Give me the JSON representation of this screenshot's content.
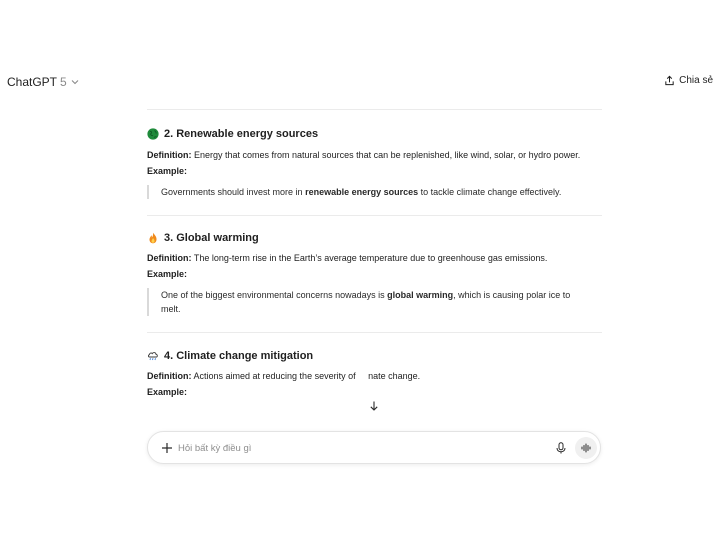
{
  "header": {
    "model_name": "ChatGPT",
    "model_version": "5",
    "share_label": "Chia sẻ"
  },
  "sections": [
    {
      "title": "2. Renewable energy sources",
      "icon": "globe-icon",
      "definition_label": "Definition:",
      "definition_text": " Energy that comes from natural sources that can be replenished, like wind, solar, or hydro power.",
      "example_label": "Example:",
      "example_before": "Governments should invest more in ",
      "example_bold": "renewable energy sources",
      "example_after": " to tackle climate change effectively."
    },
    {
      "title": "3. Global warming",
      "icon": "fire-icon",
      "definition_label": "Definition:",
      "definition_text": " The long-term rise in the Earth’s average temperature due to greenhouse gas emissions.",
      "example_label": "Example:",
      "example_before": "One of the biggest environmental concerns nowadays is ",
      "example_bold": "global warming",
      "example_after": ", which is causing polar ice to melt."
    },
    {
      "title": "4. Climate change mitigation",
      "icon": "cloud-rain-icon",
      "definition_label": "Definition:",
      "definition_text_1": " Actions aimed at reducing the severity of ",
      "definition_text_2": "nate change.",
      "example_label": "Example:"
    }
  ],
  "composer": {
    "placeholder": "Hỏi bất kỳ điều gì"
  },
  "colors": {
    "accent_green": "#1e8a3a",
    "fire_orange": "#f08a1c",
    "divider": "#ebebeb"
  }
}
